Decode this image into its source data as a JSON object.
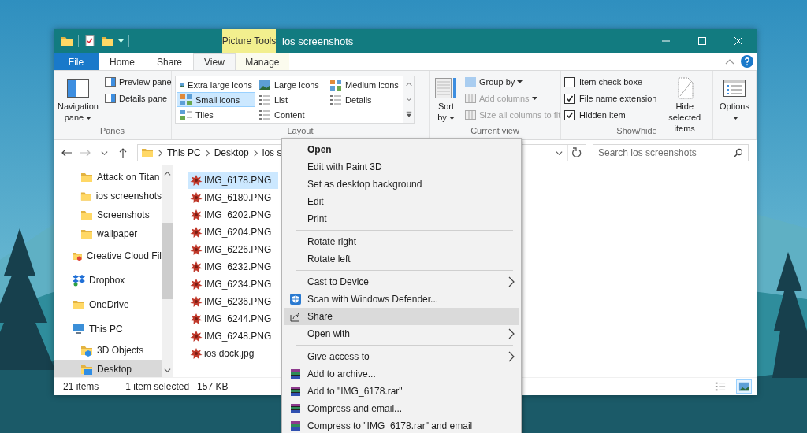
{
  "title_bar": {
    "context_label": "Picture Tools",
    "title": "ios screenshots"
  },
  "tabs": [
    {
      "label": "File",
      "kind": "file",
      "selected": false
    },
    {
      "label": "Home",
      "kind": "tab",
      "selected": false
    },
    {
      "label": "Share",
      "kind": "tab",
      "selected": false
    },
    {
      "label": "View",
      "kind": "tab",
      "selected": true
    },
    {
      "label": "Manage",
      "kind": "contextual",
      "selected": false
    }
  ],
  "ribbon": {
    "groups": [
      {
        "label": "Panes",
        "items": [
          {
            "kind": "large",
            "label": "Navigation pane",
            "dropdown": true,
            "disabled": false
          },
          {
            "kind": "stack",
            "buttons": [
              {
                "label": "Preview pane",
                "dropdown": false,
                "disabled": false
              },
              {
                "label": "Details pane",
                "dropdown": false,
                "disabled": false
              }
            ]
          }
        ]
      },
      {
        "label": "Layout",
        "items": [
          {
            "kind": "gallery",
            "options": [
              {
                "label": "Extra large icons",
                "selected": false
              },
              {
                "label": "Large icons",
                "selected": false
              },
              {
                "label": "Medium icons",
                "selected": false
              },
              {
                "label": "Small icons",
                "selected": true
              },
              {
                "label": "List",
                "selected": false
              },
              {
                "label": "Details",
                "selected": false
              },
              {
                "label": "Tiles",
                "selected": false
              },
              {
                "label": "Content",
                "selected": false
              }
            ]
          }
        ]
      },
      {
        "label": "Current view",
        "items": [
          {
            "kind": "large",
            "label": "Sort by",
            "dropdown": true,
            "disabled": false
          },
          {
            "kind": "stack",
            "buttons": [
              {
                "label": "Group by",
                "dropdown": true,
                "disabled": false
              },
              {
                "label": "Add columns",
                "dropdown": true,
                "disabled": true
              },
              {
                "label": "Size all columns to fit",
                "dropdown": false,
                "disabled": true
              }
            ]
          }
        ]
      },
      {
        "label": "Show/hide",
        "items": [
          {
            "kind": "checks",
            "checkboxes": [
              {
                "label": "Item check boxe",
                "checked": false
              },
              {
                "label": "File name extension",
                "checked": true
              },
              {
                "label": "Hidden item",
                "checked": true
              }
            ]
          },
          {
            "kind": "large",
            "label": "Hide selected items",
            "dropdown": false,
            "disabled": false
          }
        ]
      },
      {
        "items": [
          {
            "kind": "large",
            "label": "Options",
            "dropdown": true,
            "disabled": false
          }
        ]
      }
    ]
  },
  "address_bar": {
    "crumbs": [
      "This PC",
      "Desktop",
      "ios s"
    ]
  },
  "search": {
    "placeholder": "Search ios screenshots"
  },
  "nav_pane": {
    "items": [
      {
        "children": [
          {
            "label": "Attack on Titan",
            "kind": "folder",
            "selected": false
          },
          {
            "label": "ios screenshots",
            "kind": "folder",
            "selected": false
          },
          {
            "label": "Screenshots",
            "kind": "folder",
            "selected": false
          },
          {
            "label": "wallpaper",
            "kind": "folder",
            "selected": false
          }
        ]
      },
      {
        "label": "Creative Cloud Fil",
        "kind": "cloud",
        "selected": false
      },
      {
        "label": "Dropbox",
        "kind": "dropbox",
        "selected": false
      },
      {
        "label": "OneDrive",
        "kind": "folder",
        "selected": false
      },
      {
        "label": "This PC",
        "kind": "computer",
        "selected": false,
        "children": [
          {
            "label": "3D Objects",
            "kind": "objects",
            "selected": false
          },
          {
            "label": "Desktop",
            "kind": "desktop",
            "selected": true
          }
        ]
      }
    ]
  },
  "files": [
    {
      "name": "IMG_6178.PNG",
      "selected": true
    },
    {
      "name": "IMG_6180.PNG",
      "selected": false
    },
    {
      "name": "IMG_6202.PNG",
      "selected": false
    },
    {
      "name": "IMG_6204.PNG",
      "selected": false
    },
    {
      "name": "IMG_6226.PNG",
      "selected": false
    },
    {
      "name": "IMG_6232.PNG",
      "selected": false
    },
    {
      "name": "IMG_6234.PNG",
      "selected": false
    },
    {
      "name": "IMG_6236.PNG",
      "selected": false
    },
    {
      "name": "IMG_6244.PNG",
      "selected": false
    },
    {
      "name": "IMG_6248.PNG",
      "selected": false
    },
    {
      "name": "ios dock.jpg",
      "selected": false
    }
  ],
  "status_bar": {
    "item_count": "21 items",
    "selection": "1 item selected",
    "size": "157 KB",
    "view_buttons": [
      {
        "kind": "details",
        "selected": false
      },
      {
        "kind": "icons",
        "selected": true
      }
    ]
  },
  "context_menu": {
    "items": [
      {
        "kind": "text",
        "label": "Open",
        "default": true,
        "submenu": false,
        "selected": false
      },
      {
        "kind": "text",
        "label": "Edit with Paint 3D",
        "default": false,
        "submenu": false,
        "selected": false
      },
      {
        "kind": "text",
        "label": "Set as desktop background",
        "default": false,
        "submenu": false,
        "selected": false
      },
      {
        "kind": "text",
        "label": "Edit",
        "default": false,
        "submenu": false,
        "selected": false
      },
      {
        "kind": "text",
        "label": "Print",
        "default": false,
        "submenu": false,
        "selected": false
      },
      {
        "kind": "separator"
      },
      {
        "kind": "text",
        "label": "Rotate right",
        "default": false,
        "submenu": false,
        "selected": false
      },
      {
        "kind": "text",
        "label": "Rotate left",
        "default": false,
        "submenu": false,
        "selected": false
      },
      {
        "kind": "separator"
      },
      {
        "kind": "text",
        "label": "Cast to Device",
        "default": false,
        "submenu": true,
        "selected": false
      },
      {
        "kind": "shield",
        "label": "Scan with Windows Defender...",
        "default": false,
        "submenu": false,
        "selected": false
      },
      {
        "kind": "share",
        "label": "Share",
        "default": false,
        "submenu": false,
        "selected": true
      },
      {
        "kind": "text",
        "label": "Open with",
        "default": false,
        "submenu": true,
        "selected": false
      },
      {
        "kind": "separator"
      },
      {
        "kind": "text",
        "label": "Give access to",
        "default": false,
        "submenu": true,
        "selected": false
      },
      {
        "kind": "archive",
        "label": "Add to archive...",
        "default": false,
        "submenu": false,
        "selected": false
      },
      {
        "kind": "archive",
        "label": "Add to \"IMG_6178.rar\"",
        "default": false,
        "submenu": false,
        "selected": false
      },
      {
        "kind": "archive",
        "label": "Compress and email...",
        "default": false,
        "submenu": false,
        "selected": false
      },
      {
        "kind": "archive",
        "label": "Compress to \"IMG_6178.rar\" and email",
        "default": false,
        "submenu": false,
        "selected": false
      }
    ]
  }
}
